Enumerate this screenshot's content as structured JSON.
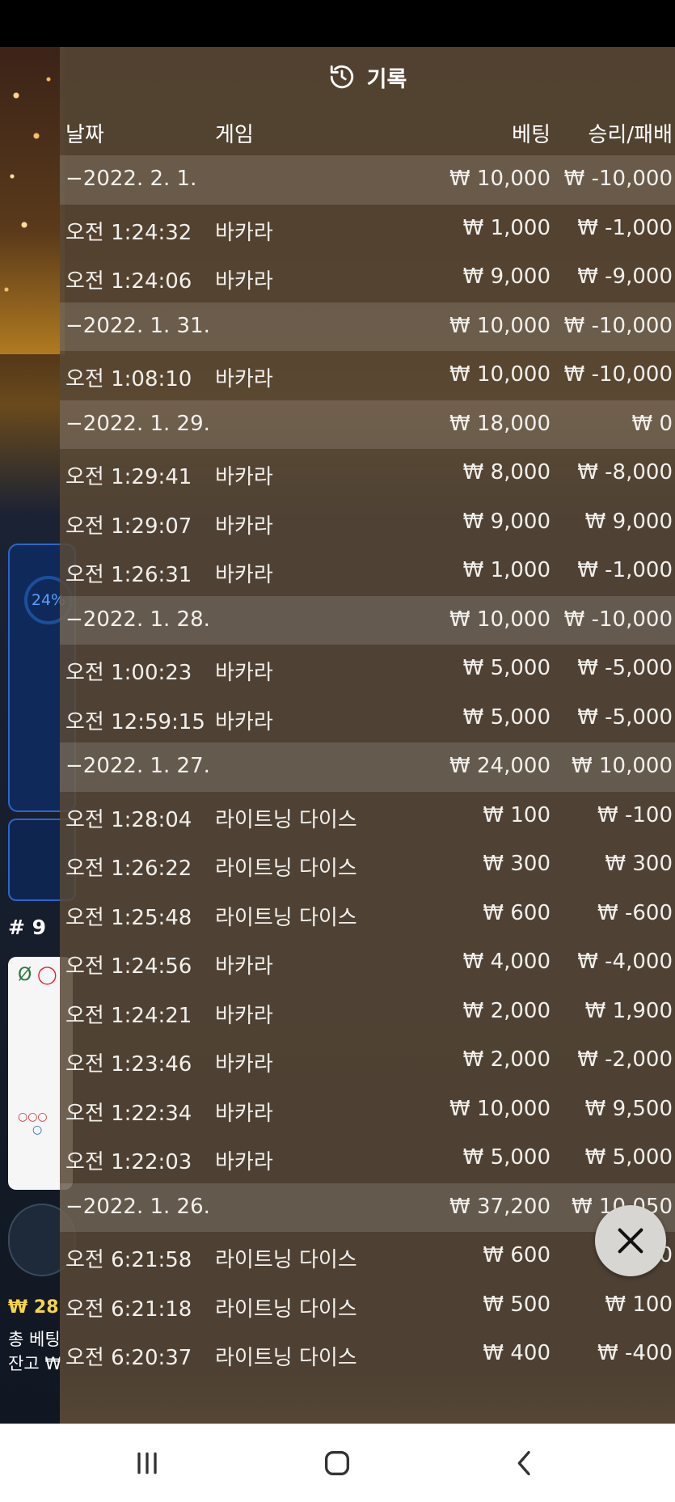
{
  "header": {
    "title": "기록",
    "icon": "history-icon"
  },
  "columns": {
    "date": "날짜",
    "game": "게임",
    "bet": "베팅",
    "result": "승리/패배"
  },
  "rows": [
    {
      "type": "date",
      "time": "−2022. 2. 1.",
      "game": "",
      "bet": "₩ 10,000",
      "result": "₩ -10,000"
    },
    {
      "type": "entry",
      "time": "오전 1:24:32",
      "game": "바카라",
      "bet": "₩ 1,000",
      "result": "₩ -1,000"
    },
    {
      "type": "entry",
      "time": "오전 1:24:06",
      "game": "바카라",
      "bet": "₩ 9,000",
      "result": "₩ -9,000"
    },
    {
      "type": "date",
      "time": "−2022. 1. 31.",
      "game": "",
      "bet": "₩ 10,000",
      "result": "₩ -10,000"
    },
    {
      "type": "entry",
      "time": "오전 1:08:10",
      "game": "바카라",
      "bet": "₩ 10,000",
      "result": "₩ -10,000"
    },
    {
      "type": "date",
      "time": "−2022. 1. 29.",
      "game": "",
      "bet": "₩ 18,000",
      "result": "₩ 0"
    },
    {
      "type": "entry",
      "time": "오전 1:29:41",
      "game": "바카라",
      "bet": "₩ 8,000",
      "result": "₩ -8,000"
    },
    {
      "type": "entry",
      "time": "오전 1:29:07",
      "game": "바카라",
      "bet": "₩ 9,000",
      "result": "₩ 9,000"
    },
    {
      "type": "entry",
      "time": "오전 1:26:31",
      "game": "바카라",
      "bet": "₩ 1,000",
      "result": "₩ -1,000"
    },
    {
      "type": "date",
      "time": "−2022. 1. 28.",
      "game": "",
      "bet": "₩ 10,000",
      "result": "₩ -10,000"
    },
    {
      "type": "entry",
      "time": "오전 1:00:23",
      "game": "바카라",
      "bet": "₩ 5,000",
      "result": "₩ -5,000"
    },
    {
      "type": "entry",
      "time": "오전 12:59:15",
      "game": "바카라",
      "bet": "₩ 5,000",
      "result": "₩ -5,000"
    },
    {
      "type": "date",
      "time": "−2022. 1. 27.",
      "game": "",
      "bet": "₩ 24,000",
      "result": "₩ 10,000"
    },
    {
      "type": "entry",
      "time": "오전 1:28:04",
      "game": "라이트닝 다이스",
      "bet": "₩ 100",
      "result": "₩ -100"
    },
    {
      "type": "entry",
      "time": "오전 1:26:22",
      "game": "라이트닝 다이스",
      "bet": "₩ 300",
      "result": "₩ 300"
    },
    {
      "type": "entry",
      "time": "오전 1:25:48",
      "game": "라이트닝 다이스",
      "bet": "₩ 600",
      "result": "₩ -600"
    },
    {
      "type": "entry",
      "time": "오전 1:24:56",
      "game": "바카라",
      "bet": "₩ 4,000",
      "result": "₩ -4,000"
    },
    {
      "type": "entry",
      "time": "오전 1:24:21",
      "game": "바카라",
      "bet": "₩ 2,000",
      "result": "₩ 1,900"
    },
    {
      "type": "entry",
      "time": "오전 1:23:46",
      "game": "바카라",
      "bet": "₩ 2,000",
      "result": "₩ -2,000"
    },
    {
      "type": "entry",
      "time": "오전 1:22:34",
      "game": "바카라",
      "bet": "₩ 10,000",
      "result": "₩ 9,500"
    },
    {
      "type": "entry",
      "time": "오전 1:22:03",
      "game": "바카라",
      "bet": "₩ 5,000",
      "result": "₩ 5,000"
    },
    {
      "type": "date",
      "time": "−2022. 1. 26.",
      "game": "",
      "bet": "₩ 37,200",
      "result": "₩ 10,050"
    },
    {
      "type": "entry",
      "time": "오전 6:21:58",
      "game": "라이트닝 다이스",
      "bet": "₩ 600",
      "result": "₩ -600"
    },
    {
      "type": "entry",
      "time": "오전 6:21:18",
      "game": "라이트닝 다이스",
      "bet": "₩ 500",
      "result": "₩ 100"
    },
    {
      "type": "entry",
      "time": "오전 6:20:37",
      "game": "라이트닝 다이스",
      "bet": "₩ 400",
      "result": "₩ -400"
    }
  ],
  "background": {
    "stat_percent": "24%",
    "round": "# 9",
    "balance_amount": "₩ 28",
    "total_bet_label": "총 베팅",
    "balance_label": "잔고 ₩"
  },
  "colors": {
    "panel": "#584836",
    "date_row_tint": "rgba(255,255,255,0.13)",
    "balance_yellow": "#f5d44a",
    "card_blue": "#2a66c9"
  },
  "controls": {
    "close_icon": "close-icon"
  },
  "nav": {
    "recent_icon": "recent-apps-icon",
    "home_icon": "home-icon",
    "back_icon": "back-icon"
  }
}
